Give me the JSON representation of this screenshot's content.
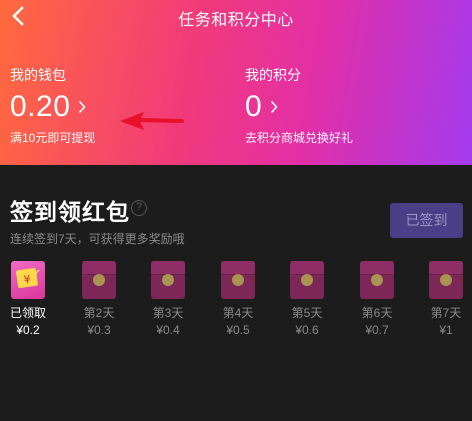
{
  "header": {
    "title": "任务和积分中心",
    "wallet": {
      "label": "我的钱包",
      "value": "0.20",
      "sub": "满10元即可提现"
    },
    "points": {
      "label": "我的积分",
      "value": "0",
      "sub": "去积分商城兑换好礼"
    }
  },
  "checkin": {
    "title": "签到领红包",
    "help": "?",
    "subtitle": "连续签到7天，可获得更多奖励哦",
    "button_label": "已签到",
    "days": [
      {
        "label": "已领取",
        "amount": "¥0.2",
        "claimed": true
      },
      {
        "label": "第2天",
        "amount": "¥0.3",
        "claimed": false
      },
      {
        "label": "第3天",
        "amount": "¥0.4",
        "claimed": false
      },
      {
        "label": "第4天",
        "amount": "¥0.5",
        "claimed": false
      },
      {
        "label": "第5天",
        "amount": "¥0.6",
        "claimed": false
      },
      {
        "label": "第6天",
        "amount": "¥0.7",
        "claimed": false
      },
      {
        "label": "第7天",
        "amount": "¥1",
        "claimed": false
      }
    ]
  },
  "colors": {
    "header_gradient": [
      "#ff6a3d",
      "#f23a7a",
      "#e32fa6",
      "#a43aef"
    ],
    "background": "#1c1c1c",
    "button_bg": "#4a3f86",
    "envelope_closed": "#7c2758",
    "arrow": "#e8102a"
  },
  "icons": [
    "back-arrow-icon",
    "chevron-right-icon",
    "help-icon",
    "red-envelope-icon",
    "red-arrow-annotation"
  ]
}
